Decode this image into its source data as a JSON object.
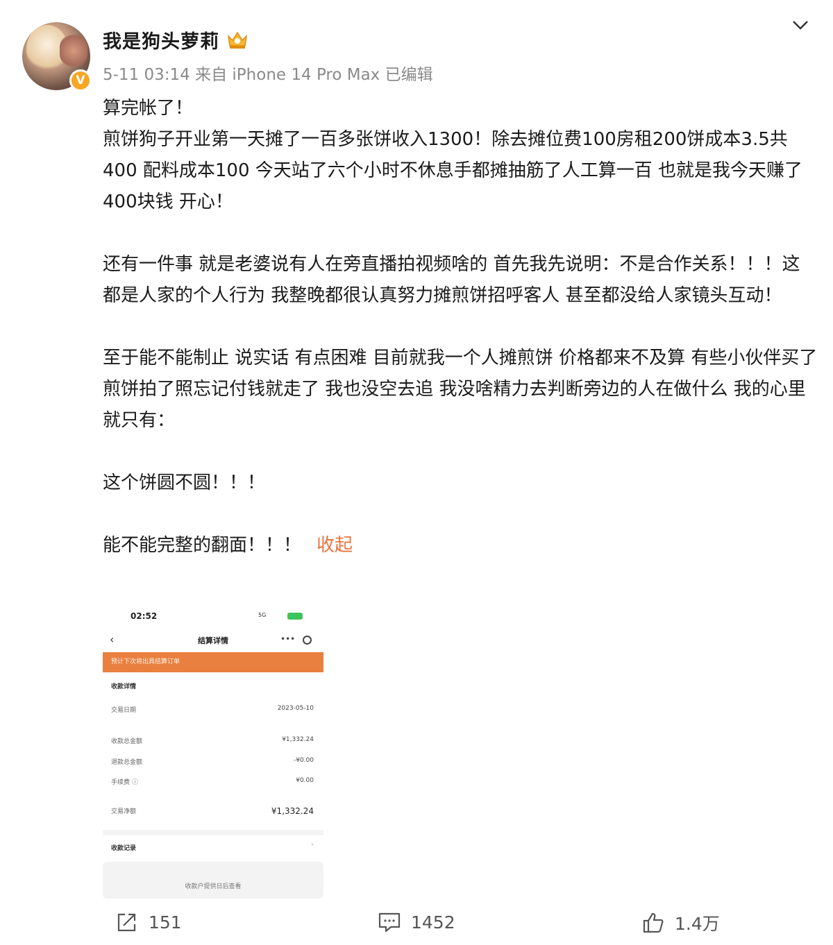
{
  "author": {
    "name": "我是狗头萝莉",
    "verified_badge": "V",
    "vip_icon": "crown-icon"
  },
  "post_meta": {
    "time": "5-11 03:14",
    "source": "来自 iPhone 14 Pro Max",
    "edited": "已编辑"
  },
  "post": {
    "lines": [
      "算完帐了！",
      "煎饼狗子开业第一天摊了一百多张饼收入1300！除去摊位费100房租200饼成本3.5共400 配料成本100 今天站了六个小时不休息手都摊抽筋了人工算一百 也就是我今天赚了400块钱 开心！",
      "还有一件事 就是老婆说有人在旁直播拍视频啥的 首先我先说明：不是合作关系！！！这都是人家的个人行为 我整晚都很认真努力摊煎饼招呼客人 甚至都没给人家镜头互动！",
      "至于能不能制止 说实话 有点困难 目前就我一个人摊煎饼 价格都来不及算 有些小伙伴买了煎饼拍了照忘记付钱就走了 我也没空去追  我没啥精力去判断旁边的人在做什么 我的心里就只有：",
      "这个饼圆不圆！！！",
      "能不能完整的翻面！！！"
    ],
    "collapse_label": "收起"
  },
  "screenshot": {
    "status_time": "02:52",
    "status_signal": "5G",
    "nav_title": "结算详情",
    "banner_text": "预计下次将出具结算订单",
    "section_title": "收款详情",
    "rows": [
      {
        "label": "交易日期",
        "value": "2023-05-10"
      },
      {
        "label": "收款总金额",
        "value": "¥1,332.24"
      },
      {
        "label": "退款总金额",
        "value": "-¥0.00"
      },
      {
        "label": "手续费 ⓘ",
        "value": "¥0.00"
      },
      {
        "label": "交易净额",
        "value": "¥1,332.24"
      }
    ],
    "records_label": "收款记录",
    "footer_text": "收款户提供日后查看"
  },
  "actions": {
    "repost_count": "151",
    "comment_count": "1452",
    "like_count": "1.4万"
  },
  "colors": {
    "accent": "#eb7340",
    "meta": "#8a8a8a",
    "banner": "#e9803f"
  }
}
